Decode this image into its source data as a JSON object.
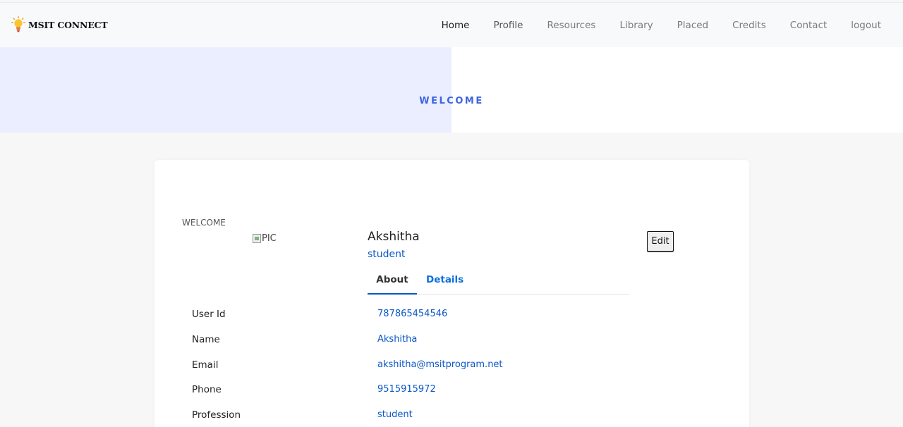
{
  "nav": {
    "brand": "MSIT CONNECT",
    "links": [
      "Home",
      "Profile",
      "Resources",
      "Library",
      "Placed",
      "Credits",
      "Contact",
      "logout"
    ]
  },
  "hero": {
    "title": "WELCOME"
  },
  "profile": {
    "greeting": "WELCOME",
    "image_alt": "PIC",
    "name": "Akshitha",
    "role": "student",
    "edit_label": "Edit",
    "tabs": [
      "About",
      "Details"
    ],
    "active_tab": "About",
    "fields": [
      {
        "label": "User Id",
        "value": "787865454546"
      },
      {
        "label": "Name",
        "value": "Akshitha"
      },
      {
        "label": "Email",
        "value": "akshitha@msitprogram.net"
      },
      {
        "label": "Phone",
        "value": "9515915972"
      },
      {
        "label": "Profession",
        "value": "student"
      }
    ]
  },
  "colors": {
    "accent": "#3d63e0",
    "link": "#0b57c6",
    "hero_bg": "#eaeefe",
    "page_bg": "#f7f7f7"
  },
  "icons": {
    "brand": "lightbulb-icon"
  }
}
